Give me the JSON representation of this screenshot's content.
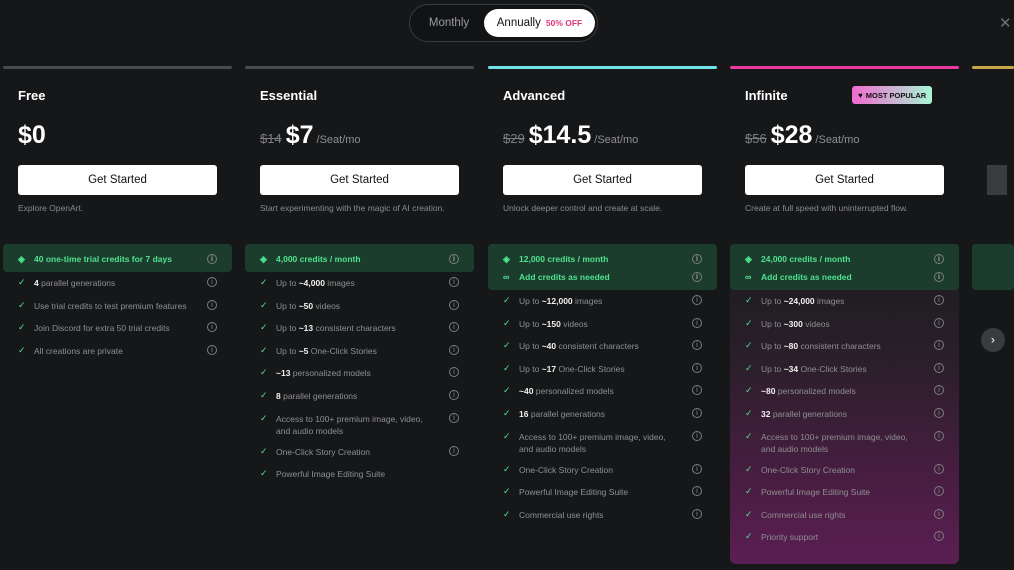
{
  "billing": {
    "monthly_label": "Monthly",
    "annually_label": "Annually",
    "discount_label": "50% OFF"
  },
  "colors": {
    "accent_green": "#4ee290",
    "free_bar": "#4a4b4d",
    "essential_bar": "#4a4b4d",
    "advanced_bar": "#6fe3e8",
    "infinite_bar": "#e83a9f",
    "badge_gradient": [
      "#f06bd0",
      "#a8f5d4"
    ]
  },
  "plans": [
    {
      "name": "Free",
      "old_price": "",
      "price": "$0",
      "unit": "",
      "cta": "Get Started",
      "description": "Explore OpenArt.",
      "credits": [
        "40 one-time trial credits for 7 days"
      ],
      "features": [
        [
          "4",
          " parallel generations"
        ],
        [
          "",
          "Use trial credits to test premium features"
        ],
        [
          "",
          "Join Discord for extra 50 trial credits"
        ],
        [
          "",
          "All creations are private"
        ]
      ]
    },
    {
      "name": "Essential",
      "old_price": "$14",
      "price": "$7",
      "unit": "/Seat/mo",
      "cta": "Get Started",
      "description": "Start experimenting with the magic of AI creation.",
      "credits": [
        "4,000 credits / month"
      ],
      "features": [
        [
          "Up to ",
          "~4,000",
          " images"
        ],
        [
          "Up to ",
          "~50",
          " videos"
        ],
        [
          "Up to ",
          "~13",
          " consistent characters"
        ],
        [
          "Up to ",
          "~5",
          " One-Click Stories"
        ],
        [
          "",
          "~13",
          " personalized models"
        ],
        [
          "",
          "8",
          " parallel generations"
        ],
        [
          "",
          "",
          "Access to 100+ premium image, video, and audio models"
        ],
        [
          "",
          "",
          "One-Click Story Creation"
        ],
        [
          "",
          "",
          "Powerful Image Editing Suite"
        ]
      ]
    },
    {
      "name": "Advanced",
      "old_price": "$29",
      "price": "$14.5",
      "unit": "/Seat/mo",
      "cta": "Get Started",
      "description": "Unlock deeper control and create at scale.",
      "credits": [
        "12,000 credits / month",
        "Add credits as needed"
      ],
      "features": [
        [
          "Up to ",
          "~12,000",
          " images"
        ],
        [
          "Up to ",
          "~150",
          " videos"
        ],
        [
          "Up to ",
          "~40",
          " consistent characters"
        ],
        [
          "Up to ",
          "~17",
          " One-Click Stories"
        ],
        [
          "",
          "~40",
          " personalized models"
        ],
        [
          "",
          "16",
          " parallel generations"
        ],
        [
          "",
          "",
          "Access to 100+ premium image, video, and audio models"
        ],
        [
          "",
          "",
          "One-Click Story Creation"
        ],
        [
          "",
          "",
          "Powerful Image Editing Suite"
        ],
        [
          "",
          "",
          "Commercial use rights"
        ]
      ]
    },
    {
      "name": "Infinite",
      "old_price": "$56",
      "price": "$28",
      "unit": "/Seat/mo",
      "cta": "Get Started",
      "description": "Create at full speed with uninterrupted flow.",
      "badge": "MOST POPULAR",
      "credits": [
        "24,000 credits / month",
        "Add credits as needed"
      ],
      "features": [
        [
          "Up to ",
          "~24,000",
          " images"
        ],
        [
          "Up to ",
          "~300",
          " videos"
        ],
        [
          "Up to ",
          "~80",
          " consistent characters"
        ],
        [
          "Up to ",
          "~34",
          " One-Click Stories"
        ],
        [
          "",
          "~80",
          " personalized models"
        ],
        [
          "",
          "32",
          " parallel generations"
        ],
        [
          "",
          "",
          "Access to 100+ premium image, video, and audio models"
        ],
        [
          "",
          "",
          "One-Click Story Creation"
        ],
        [
          "",
          "",
          "Powerful Image Editing Suite"
        ],
        [
          "",
          "",
          "Commercial use rights"
        ],
        [
          "",
          "",
          "Priority support"
        ]
      ]
    }
  ],
  "icons": {
    "close": "close-icon",
    "next": "chevron-right-icon",
    "credit": "diamond-icon",
    "infinity": "infinity-icon",
    "check": "check-icon",
    "info": "info-icon",
    "heart": "heart-icon"
  }
}
